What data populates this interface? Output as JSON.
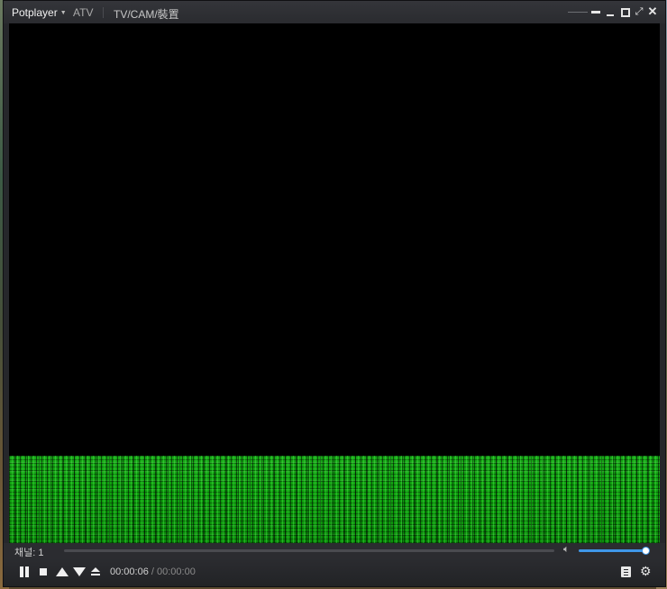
{
  "titlebar": {
    "app_name": "Potplayer",
    "mode": "ATV",
    "source": "TV/CAM/裝置"
  },
  "window_controls": {
    "pin_icon": "pin-icon",
    "minimize_icon": "minimize-icon",
    "maximize_icon": "maximize-icon",
    "fullscreen_icon": "fullscreen-icon",
    "close_icon": "close-icon"
  },
  "status": {
    "channel_label": "채널: 1"
  },
  "playback": {
    "elapsed": "00:00:06",
    "separator": "/",
    "total": "00:00:00",
    "volume_level_pct": 100
  },
  "icons": {
    "pause": "pause-icon",
    "stop": "stop-icon",
    "prev": "triangle-up-icon",
    "next": "triangle-down-icon",
    "eject": "eject-icon",
    "volume": "speaker-icon",
    "playlist": "playlist-icon",
    "settings": "gear-icon"
  },
  "colors": {
    "accent": "#3f97e8",
    "video_noise": "#12a012",
    "chrome": "#26272b"
  }
}
